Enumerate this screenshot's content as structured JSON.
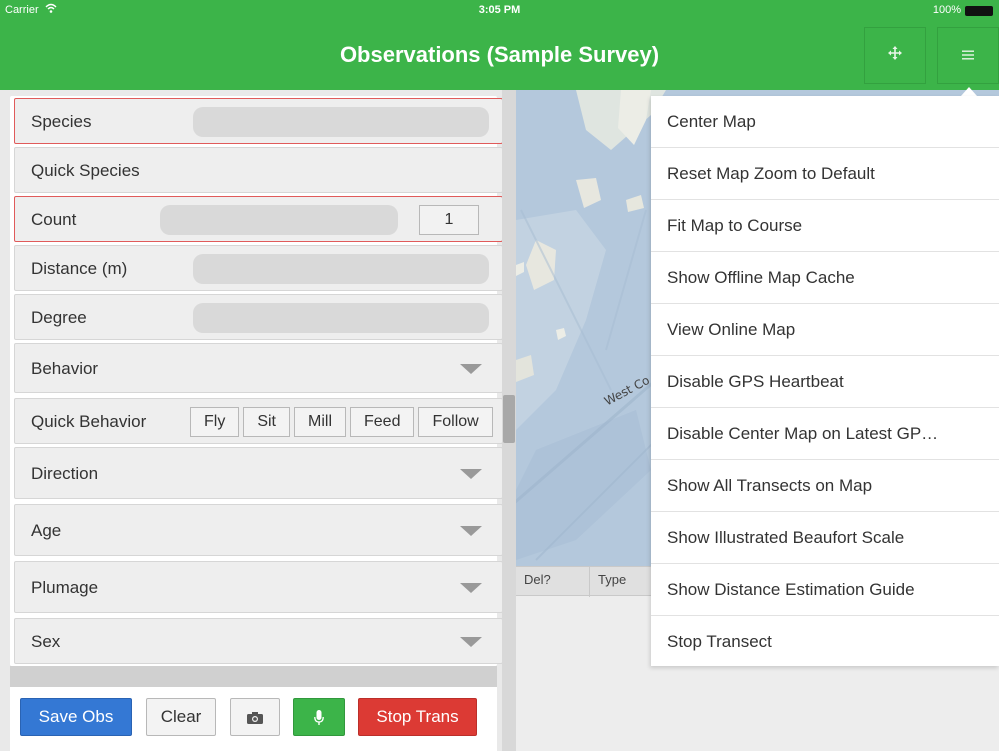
{
  "status_bar": {
    "carrier": "Carrier",
    "time": "3:05 PM",
    "battery": "100%"
  },
  "nav": {
    "title": "Observations (Sample Survey)",
    "move_icon": "move-arrows-icon",
    "menu_icon": "hamburger-icon"
  },
  "form": {
    "species": {
      "label": "Species"
    },
    "quick_species": {
      "label": "Quick Species"
    },
    "count": {
      "label": "Count",
      "value": "1"
    },
    "distance": {
      "label": "Distance (m)"
    },
    "degree": {
      "label": "Degree"
    },
    "behavior": {
      "label": "Behavior"
    },
    "quick_behavior": {
      "label": "Quick Behavior",
      "options": [
        "Fly",
        "Sit",
        "Mill",
        "Feed",
        "Follow"
      ]
    },
    "direction": {
      "label": "Direction"
    },
    "age": {
      "label": "Age"
    },
    "plumage": {
      "label": "Plumage"
    },
    "sex": {
      "label": "Sex"
    }
  },
  "toolbar": {
    "save": "Save Obs",
    "clear": "Clear",
    "camera_icon": "camera-icon",
    "mic_icon": "microphone-icon",
    "stop": "Stop Trans"
  },
  "map": {
    "label": "West Co"
  },
  "table": {
    "columns": [
      "Del?",
      "Type"
    ]
  },
  "menu": {
    "items": [
      "Center Map",
      "Reset Map Zoom to Default",
      "Fit Map to Course",
      "Show Offline Map Cache",
      "View Online Map",
      "Disable GPS Heartbeat",
      "Disable Center Map on Latest GP…",
      "Show All Transects on Map",
      "Show Illustrated Beaufort Scale",
      "Show Distance Estimation Guide",
      "Stop Transect"
    ]
  },
  "colors": {
    "green": "#3cb449",
    "blue": "#3478d4",
    "red": "#dc3a34",
    "required_border": "#e05a5a"
  }
}
